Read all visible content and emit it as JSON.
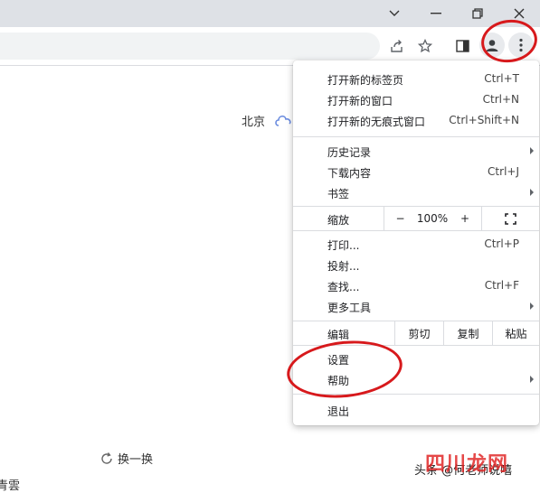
{
  "window": {
    "controls": {
      "chevron": "chevron-down-icon",
      "minimize": "minimize-icon",
      "restore": "restore-icon",
      "close": "close-icon"
    }
  },
  "toolbar": {
    "icons": [
      "share-icon",
      "star-icon",
      "side-panel-icon",
      "profile-icon",
      "more-vert-icon"
    ]
  },
  "page": {
    "location": "北京",
    "refresh_label": "换一换",
    "bottom_fragment": "青雲"
  },
  "menu": {
    "items": [
      {
        "label": "打开新的标签页",
        "shortcut": "Ctrl+T"
      },
      {
        "label": "打开新的窗口",
        "shortcut": "Ctrl+N"
      },
      {
        "label": "打开新的无痕式窗口",
        "shortcut": "Ctrl+Shift+N"
      },
      {
        "label": "历史记录",
        "shortcut": ""
      },
      {
        "label": "下载内容",
        "shortcut": "Ctrl+J"
      },
      {
        "label": "书签",
        "shortcut": ""
      },
      {
        "label": "打印...",
        "shortcut": "Ctrl+P"
      },
      {
        "label": "投射...",
        "shortcut": ""
      },
      {
        "label": "查找...",
        "shortcut": "Ctrl+F"
      },
      {
        "label": "更多工具",
        "shortcut": ""
      },
      {
        "label": "设置",
        "shortcut": ""
      },
      {
        "label": "帮助",
        "shortcut": ""
      },
      {
        "label": "退出",
        "shortcut": ""
      }
    ],
    "zoom": {
      "label": "缩放",
      "minus": "−",
      "value": "100%",
      "plus": "+"
    },
    "edit": {
      "label": "编辑",
      "cut": "剪切",
      "copy": "复制",
      "paste": "粘贴"
    }
  },
  "watermark": {
    "source": "头条 @何老师说嘻",
    "logo_text": "四川龙网"
  },
  "colors": {
    "annotation_ring": "#d7191c",
    "logo_red": "#e02020"
  }
}
